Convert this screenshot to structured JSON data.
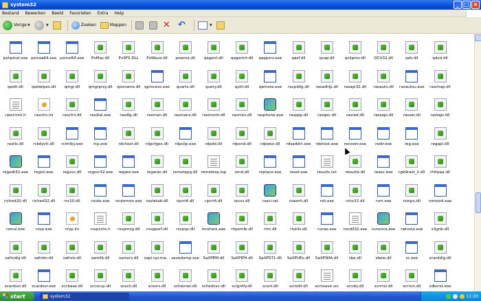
{
  "window": {
    "title": "system32"
  },
  "menu": [
    "Bestand",
    "Bewerken",
    "Beeld",
    "Favorieten",
    "Extra",
    "Help"
  ],
  "toolbar": {
    "back_label": "Vorige",
    "search_label": "Zoeken",
    "folders_label": "Mappen"
  },
  "files": [
    {
      "name": "pxhpinst.exe",
      "type": "exe"
    },
    {
      "name": "pxinsa64.exe",
      "type": "exe"
    },
    {
      "name": "pxinsi64.exe",
      "type": "exe"
    },
    {
      "name": "PxMas.dll",
      "type": "dll"
    },
    {
      "name": "PxSFS.DLL",
      "type": "dll"
    },
    {
      "name": "PxWave.dll",
      "type": "dll"
    },
    {
      "name": "pxwma.dll",
      "type": "dll"
    },
    {
      "name": "qagent.dll",
      "type": "dll"
    },
    {
      "name": "qagentrt.dll",
      "type": "dll"
    },
    {
      "name": "qappsrv.exe",
      "type": "exe"
    },
    {
      "name": "qasf.dll",
      "type": "dll"
    },
    {
      "name": "qcap.dll",
      "type": "dll"
    },
    {
      "name": "qcliprov.dll",
      "type": "dll"
    },
    {
      "name": "QCU32.dll",
      "type": "dll"
    },
    {
      "name": "qdv.dll",
      "type": "dll"
    },
    {
      "name": "qdvd.dll",
      "type": "dll"
    },
    {
      "name": "qedit.dll",
      "type": "dll"
    },
    {
      "name": "qedwipes.dll",
      "type": "dll"
    },
    {
      "name": "qmgr.dll",
      "type": "dll"
    },
    {
      "name": "qmgrprxy.dll",
      "type": "dll"
    },
    {
      "name": "qosname.dll",
      "type": "dll"
    },
    {
      "name": "qprocess.exe",
      "type": "exe"
    },
    {
      "name": "quartz.dll",
      "type": "dll"
    },
    {
      "name": "query.dll",
      "type": "dll"
    },
    {
      "name": "qutil.dll",
      "type": "dll"
    },
    {
      "name": "qwinsta.exe",
      "type": "exe"
    },
    {
      "name": "racpldlg.dll",
      "type": "dll"
    },
    {
      "name": "rasadhlp.dll",
      "type": "dll"
    },
    {
      "name": "rasapi32.dll",
      "type": "dll"
    },
    {
      "name": "rasauto.dll",
      "type": "dll"
    },
    {
      "name": "rasautou.exe",
      "type": "exe"
    },
    {
      "name": "raschap.dll",
      "type": "dll"
    },
    {
      "name": "rasctrnm.h",
      "type": "txt"
    },
    {
      "name": "rasctrs.ini",
      "type": "ini"
    },
    {
      "name": "rasctrs.dll",
      "type": "dll"
    },
    {
      "name": "rasdial.exe",
      "type": "exe"
    },
    {
      "name": "rasdlg.dll",
      "type": "dll"
    },
    {
      "name": "rasman.dll",
      "type": "dll"
    },
    {
      "name": "rasmans.dll",
      "type": "dll"
    },
    {
      "name": "rasmontr.dll",
      "type": "dll"
    },
    {
      "name": "rasmxs.dll",
      "type": "dll"
    },
    {
      "name": "rasphone.exe",
      "type": "special"
    },
    {
      "name": "rasppp.dll",
      "type": "dll"
    },
    {
      "name": "rasqec.dll",
      "type": "dll"
    },
    {
      "name": "rasrad.dll",
      "type": "dll"
    },
    {
      "name": "rassapi.dll",
      "type": "dll"
    },
    {
      "name": "rasser.dll",
      "type": "dll"
    },
    {
      "name": "rastapi.dll",
      "type": "dll"
    },
    {
      "name": "rastls.dll",
      "type": "dll"
    },
    {
      "name": "rcbdyctl.dll",
      "type": "dll"
    },
    {
      "name": "rcimlby.exe",
      "type": "exe"
    },
    {
      "name": "rcp.exe",
      "type": "exe"
    },
    {
      "name": "rdchost.dll",
      "type": "dll"
    },
    {
      "name": "rdpcfgex.dll",
      "type": "dll"
    },
    {
      "name": "rdpclip.exe",
      "type": "exe"
    },
    {
      "name": "rdpdd.dll",
      "type": "dll"
    },
    {
      "name": "rdpsnd.dll",
      "type": "dll"
    },
    {
      "name": "rdpwsx.dll",
      "type": "dll"
    },
    {
      "name": "rdsaddin.exe",
      "type": "exe"
    },
    {
      "name": "rdshost.exe",
      "type": "exe"
    },
    {
      "name": "recover.exe",
      "type": "exe"
    },
    {
      "name": "redir.exe",
      "type": "exe"
    },
    {
      "name": "reg.exe",
      "type": "exe"
    },
    {
      "name": "regapi.dll",
      "type": "dll"
    },
    {
      "name": "regedt32.exe",
      "type": "special"
    },
    {
      "name": "regini.exe",
      "type": "exe"
    },
    {
      "name": "regsvc.dll",
      "type": "dll"
    },
    {
      "name": "regsvr32.exe",
      "type": "exe"
    },
    {
      "name": "regwiz.exe",
      "type": "exe"
    },
    {
      "name": "regwizc.dll",
      "type": "dll"
    },
    {
      "name": "remotepg.dll",
      "type": "dll"
    },
    {
      "name": "remotesp.tsp",
      "type": "txt"
    },
    {
      "name": "rend.dll",
      "type": "dll"
    },
    {
      "name": "replace.exe",
      "type": "exe"
    },
    {
      "name": "reset.exe",
      "type": "exe"
    },
    {
      "name": "results.txt",
      "type": "txt"
    },
    {
      "name": "resutils.dll",
      "type": "dll"
    },
    {
      "name": "rexec.exe",
      "type": "exe"
    },
    {
      "name": "rgb9rast_2.dll",
      "type": "dll"
    },
    {
      "name": "rhttpaa.dll",
      "type": "dll"
    },
    {
      "name": "riched20.dll",
      "type": "dll"
    },
    {
      "name": "riched32.dll",
      "type": "dll"
    },
    {
      "name": "rnr20.dll",
      "type": "dll"
    },
    {
      "name": "route.exe",
      "type": "exe"
    },
    {
      "name": "routemon.exe",
      "type": "exe"
    },
    {
      "name": "routetab.dll",
      "type": "dll"
    },
    {
      "name": "rpcrt4.dll",
      "type": "dll"
    },
    {
      "name": "rpcrt4.dll",
      "type": "dll"
    },
    {
      "name": "rpcss.dll",
      "type": "dll"
    },
    {
      "name": "rsaci.rat",
      "type": "special"
    },
    {
      "name": "rsaenh.dll",
      "type": "dll"
    },
    {
      "name": "rsh.exe",
      "type": "exe"
    },
    {
      "name": "rshx32.dll",
      "type": "dll"
    },
    {
      "name": "rsm.exe",
      "type": "exe"
    },
    {
      "name": "rsmps.dll",
      "type": "dll"
    },
    {
      "name": "rsmsink.exe",
      "type": "exe"
    },
    {
      "name": "rsmui.exe",
      "type": "special"
    },
    {
      "name": "rsvp.exe",
      "type": "exe"
    },
    {
      "name": "rsvp.ini",
      "type": "ini"
    },
    {
      "name": "rsvpcnts.h",
      "type": "txt"
    },
    {
      "name": "rsvpmsg.dll",
      "type": "dll"
    },
    {
      "name": "rsvpperf.dll",
      "type": "dll"
    },
    {
      "name": "rsvpsp.dll",
      "type": "dll"
    },
    {
      "name": "rtcshare.exe",
      "type": "special"
    },
    {
      "name": "rtipxmib.dll",
      "type": "dll"
    },
    {
      "name": "rtm.dll",
      "type": "dll"
    },
    {
      "name": "rtutils.dll",
      "type": "dll"
    },
    {
      "name": "runas.exe",
      "type": "exe"
    },
    {
      "name": "rundll32.exe",
      "type": "txt"
    },
    {
      "name": "runonce.exe",
      "type": "special"
    },
    {
      "name": "rwinsta.exe",
      "type": "exe"
    },
    {
      "name": "s3gnb.dll",
      "type": "dll"
    },
    {
      "name": "safrcdlg.dll",
      "type": "dll"
    },
    {
      "name": "safrdm.dll",
      "type": "dll"
    },
    {
      "name": "safrslv.dll",
      "type": "dll"
    },
    {
      "name": "samlib.dll",
      "type": "dll"
    },
    {
      "name": "samsrv.dll",
      "type": "dll"
    },
    {
      "name": "sapi.cpl.ma...",
      "type": "dll"
    },
    {
      "name": "savedump.exe",
      "type": "exe"
    },
    {
      "name": "SaXPEM.dll",
      "type": "dll"
    },
    {
      "name": "SaXPIPH.dll",
      "type": "dll"
    },
    {
      "name": "SaXPST1.dll",
      "type": "dll"
    },
    {
      "name": "SaXPUEx.dll",
      "type": "dll"
    },
    {
      "name": "SaXPWIA.dll",
      "type": "dll"
    },
    {
      "name": "sbe.dll",
      "type": "dll"
    },
    {
      "name": "sbeio.dll",
      "type": "dll"
    },
    {
      "name": "sc.exe",
      "type": "exe"
    },
    {
      "name": "scarddlg.dll",
      "type": "dll"
    },
    {
      "name": "scardsvr.dll",
      "type": "dll"
    },
    {
      "name": "scardsvr.exe",
      "type": "exe"
    },
    {
      "name": "sccbase.dll",
      "type": "dll"
    },
    {
      "name": "sccsccp.dll",
      "type": "dll"
    },
    {
      "name": "scecli.dll",
      "type": "dll"
    },
    {
      "name": "scesrv.dll",
      "type": "dll"
    },
    {
      "name": "schannel.dll",
      "type": "dll"
    },
    {
      "name": "schedsvc.dll",
      "type": "dll"
    },
    {
      "name": "sclgntfy.dll",
      "type": "dll"
    },
    {
      "name": "sconl.dll",
      "type": "dll"
    },
    {
      "name": "scredir.dll",
      "type": "dll"
    },
    {
      "name": "scrnsave.scr",
      "type": "txt"
    },
    {
      "name": "scrobj.dll",
      "type": "dll"
    },
    {
      "name": "scrrnsl.dll",
      "type": "dll"
    },
    {
      "name": "scrrun.dll",
      "type": "dll"
    },
    {
      "name": "sdbinst.exe",
      "type": "exe"
    }
  ],
  "taskbar": {
    "start_label": "start",
    "task_label": "system32",
    "clock": "11:20"
  }
}
